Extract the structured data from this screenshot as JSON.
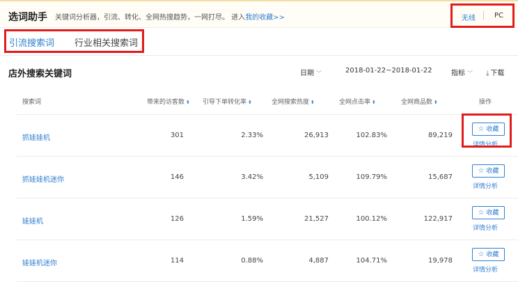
{
  "header": {
    "title": "选词助手",
    "intro_text": "关键词分析器，引流、转化、全网热搜趋势，一网打尽。 进入",
    "intro_link": "我的收藏>>",
    "devices": [
      "无线",
      "PC"
    ]
  },
  "tabs": [
    {
      "label": "引流搜索词",
      "active": true
    },
    {
      "label": "行业相关搜索词",
      "active": false
    }
  ],
  "section": {
    "title": "店外搜索关键词",
    "date_label": "日期",
    "date_range": "2018-01-22~2018-01-22",
    "metric_label": "指标",
    "download_label": "下载"
  },
  "table": {
    "columns": [
      "搜索词",
      "带来的访客数",
      "引导下单转化率",
      "全网搜索热度",
      "全网点击率",
      "全网商品数",
      "操作"
    ],
    "rows": [
      {
        "keyword": "抓娃娃机",
        "visitors": "301",
        "conversion": "2.33%",
        "heat": "26,913",
        "ctr": "102.83%",
        "products": "89,219"
      },
      {
        "keyword": "抓娃娃机迷你",
        "visitors": "146",
        "conversion": "3.42%",
        "heat": "5,109",
        "ctr": "109.79%",
        "products": "15,687"
      },
      {
        "keyword": "娃娃机",
        "visitors": "126",
        "conversion": "1.59%",
        "heat": "21,527",
        "ctr": "100.12%",
        "products": "122,917"
      },
      {
        "keyword": "娃娃机迷你",
        "visitors": "114",
        "conversion": "0.88%",
        "heat": "4,887",
        "ctr": "104.71%",
        "products": "19,978"
      }
    ],
    "fav_label": "收藏",
    "detail_label": "详情分析"
  },
  "colors": {
    "accent": "#2f7fd0",
    "highlight": "#e11b1b"
  },
  "icons": [
    "chevron-down-icon",
    "download-icon",
    "sort-icon",
    "star-icon"
  ]
}
